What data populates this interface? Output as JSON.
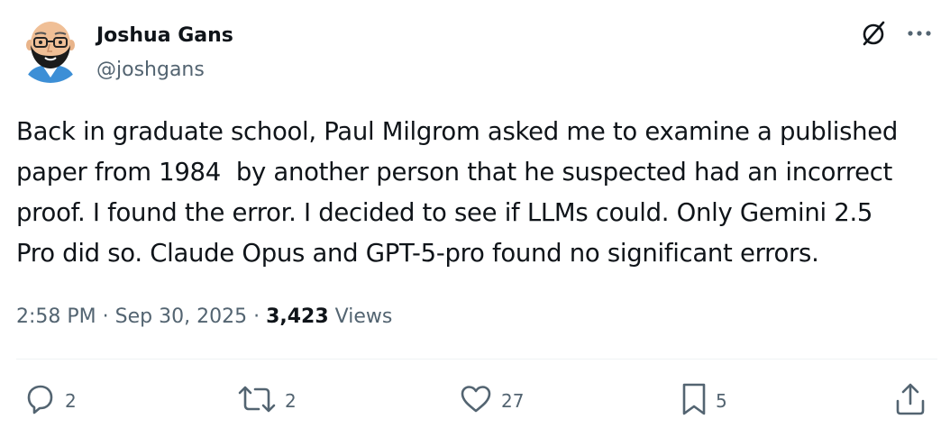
{
  "author": {
    "display_name": "Joshua Gans",
    "handle": "@joshgans"
  },
  "tweet": {
    "text": "Back in graduate school, Paul Milgrom asked me to examine a published\npaper from 1984  by another person that he suspected had an incorrect\nproof. I found the error. I decided to see if LLMs could. Only Gemini 2.5\nPro did so. Claude Opus and GPT-5-pro found no significant errors."
  },
  "meta": {
    "time": "2:58 PM",
    "sep1": " · ",
    "date": "Sep 30, 2025",
    "sep2": " · ",
    "views_count": "3,423",
    "views_label": " Views"
  },
  "actions": {
    "replies": "2",
    "reposts": "2",
    "likes": "27",
    "bookmarks": "5"
  },
  "icons": {
    "grok": "grok-icon",
    "more": "more-icon",
    "reply": "reply-icon",
    "repost": "repost-icon",
    "like": "heart-icon",
    "bookmark": "bookmark-icon",
    "share": "share-icon"
  },
  "colors": {
    "text_primary": "#0f1419",
    "text_secondary": "#536471",
    "divider": "#eff3f4"
  }
}
